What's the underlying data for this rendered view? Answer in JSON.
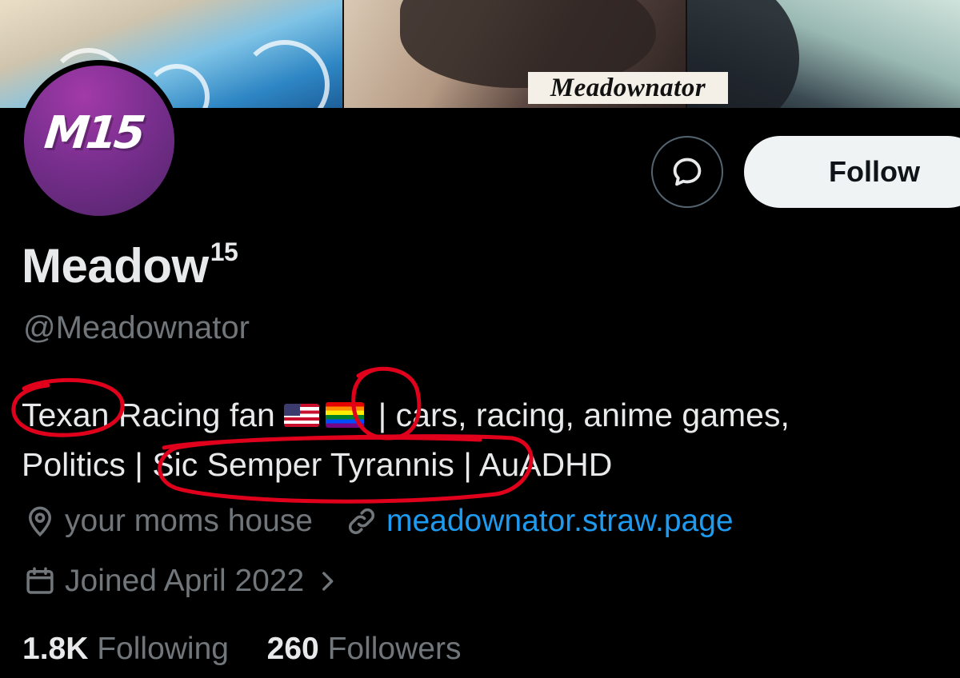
{
  "banner": {
    "watermark": "Meadownator"
  },
  "avatar": {
    "text": "M15"
  },
  "actions": {
    "follow_label": "Follow",
    "message_icon": "message-bubble-icon"
  },
  "profile": {
    "display_name": "Meadow",
    "display_name_suffix": "15",
    "handle": "@Meadownator",
    "bio": {
      "line1_a": "Texan",
      "line1_b": " Racing fan ",
      "line1_c": " | cars, racing, anime games,",
      "line2_a": "Politics | ",
      "line2_b": "Sic Semper Tyrannis",
      "line2_c": " | AuADHD"
    },
    "location": "your moms house",
    "website": "meadownator.straw.page",
    "joined": "Joined April 2022"
  },
  "stats": {
    "following_count": "1.8K",
    "following_label": "Following",
    "followers_count": "260",
    "followers_label": "Followers"
  },
  "colors": {
    "background": "#000000",
    "link": "#1d9bf0",
    "annotation": "#e0001b"
  }
}
